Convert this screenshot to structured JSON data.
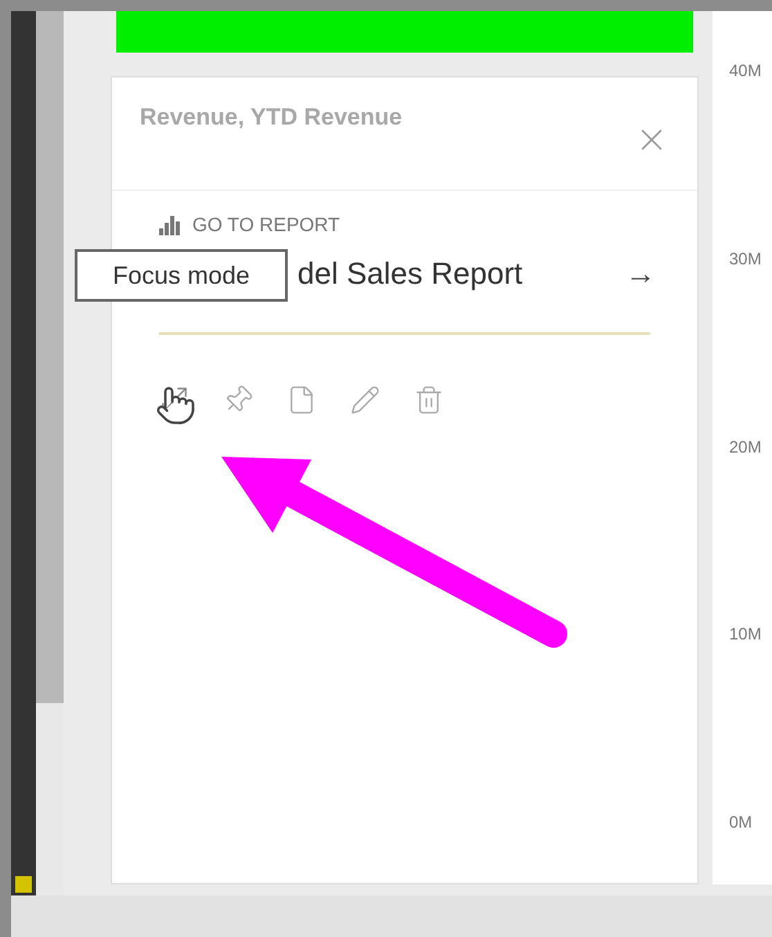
{
  "card": {
    "title": "Revenue, YTD Revenue",
    "go_to_report": "GO TO REPORT",
    "report_name": "del Sales Report",
    "arrow": "→"
  },
  "axis_labels": [
    "40M",
    "30M",
    "20M",
    "10M",
    "0M"
  ],
  "tooltip": {
    "text": "Focus mode"
  }
}
